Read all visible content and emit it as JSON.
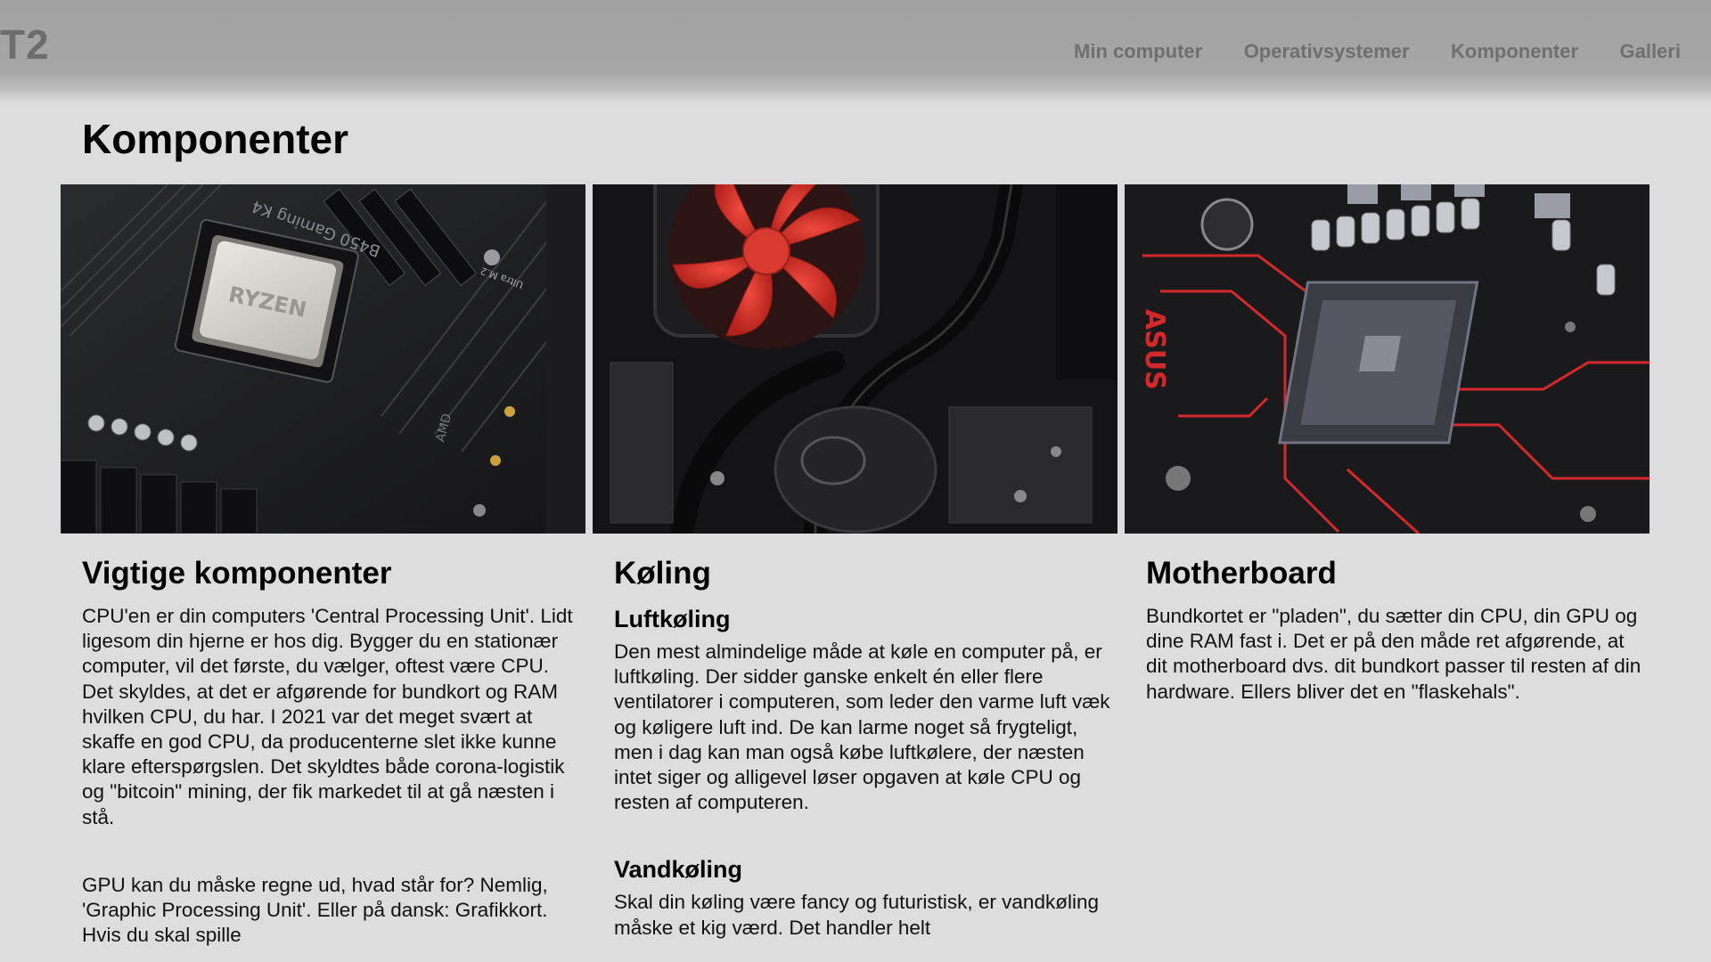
{
  "header": {
    "logo": "T2",
    "nav": [
      "Min computer",
      "Operativsystemer",
      "Komponenter",
      "Galleri"
    ]
  },
  "page_title": "Komponenter",
  "sections": {
    "components": {
      "title": "Vigtige komponenter",
      "p1": "CPU'en er din computers 'Central Processing Unit'. Lidt ligesom din hjerne er hos dig. Bygger du en stationær computer, vil det første, du vælger, oftest være CPU. Det skyldes, at det er afgørende for bundkort og RAM hvilken CPU, du har. I 2021 var det meget svært at skaffe en god CPU, da producenterne slet ikke kunne klare efterspørgslen. Det skyldtes både corona-logistik og \"bitcoin\" mining, der fik markedet til at gå næsten i stå.",
      "p2": "GPU kan du måske regne ud, hvad står for? Nemlig, 'Graphic Processing Unit'. Eller på dansk: Grafikkort. Hvis du skal spille"
    },
    "cooling": {
      "title": "Køling",
      "air_title": "Luftkøling",
      "air_text": "Den mest almindelige måde at køle en computer på, er luftkøling. Der sidder ganske enkelt én eller flere ventilatorer i computeren, som leder den varme luft væk og køligere luft ind. De kan larme noget så frygteligt, men i dag kan man også købe luftkølere, der næsten intet siger og alligevel løser opgaven at køle CPU og resten af computeren.",
      "water_title": "Vandkøling",
      "water_text": "Skal din køling være fancy og futuristisk, er vandkøling måske et kig værd. Det handler helt"
    },
    "motherboard": {
      "title": "Motherboard",
      "text": "Bundkortet er \"pladen\", du sætter din CPU, din GPU og dine RAM fast i. Det er på den måde ret afgørende, at dit motherboard dvs. dit bundkort passer til resten af din hardware. Ellers bliver det en \"flaskehals\"."
    }
  },
  "images": {
    "cpu": {
      "chip_text": "RYZEN",
      "board_text": "B450 Gaming K4",
      "m2_text": "Ultra M.2",
      "side_text": "AMD"
    },
    "motherboard": {
      "brand_text": "ASUS"
    }
  }
}
